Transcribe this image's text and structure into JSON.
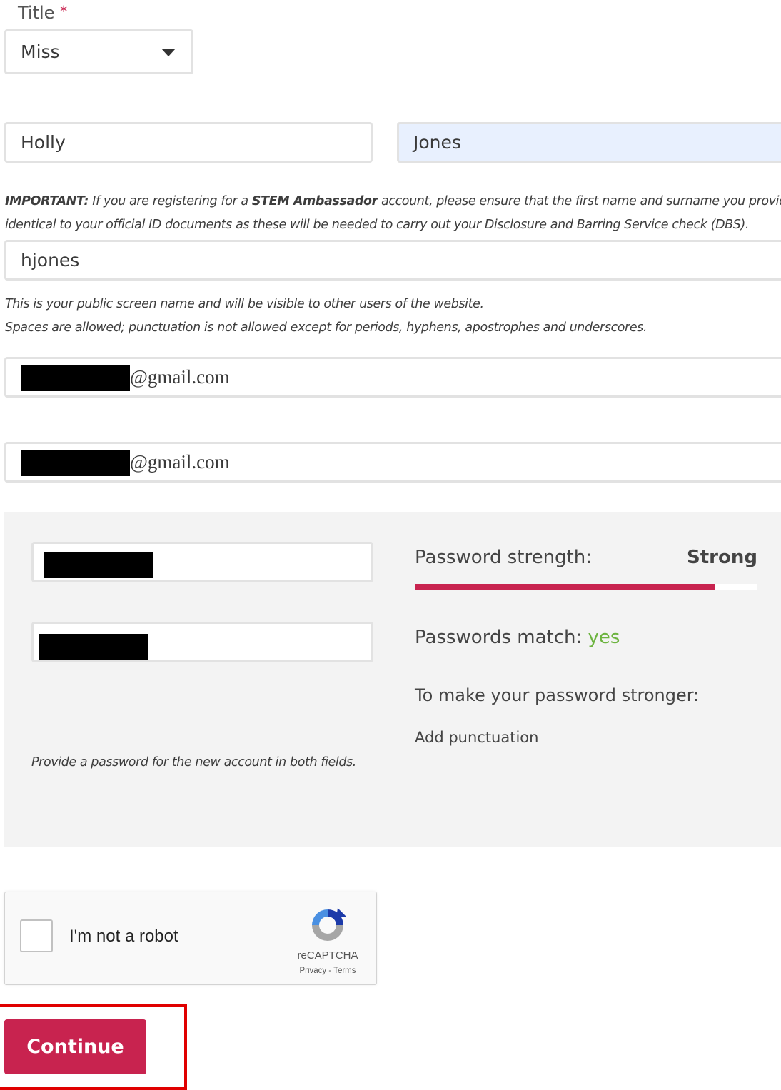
{
  "title_field": {
    "label": "Title",
    "required_mark": "*",
    "value": "Miss"
  },
  "first_name": {
    "value": "Holly"
  },
  "last_name": {
    "value": "Jones"
  },
  "important_note": {
    "prefix": "IMPORTANT:",
    "part1": " If you are registering for a ",
    "emphasis": "STEM Ambassador",
    "part2": " account, please ensure that the first name and surname you provide are",
    "line2": "identical to your official ID documents as these will be needed to carry out your Disclosure and Barring Service check (DBS)."
  },
  "screen_name": {
    "value": "hjones",
    "help_line1": "This is your public screen name and will be visible to other users of the website.",
    "help_line2": "Spaces are allowed; punctuation is not allowed except for periods, hyphens, apostrophes and underscores."
  },
  "email": {
    "suffix": "@gmail.com"
  },
  "email_confirm": {
    "suffix": "@gmail.com"
  },
  "password": {
    "strength_label": "Password strength:",
    "strength_value": "Strong",
    "strength_level": 0.875,
    "match_label": "Passwords match:",
    "match_value": "yes",
    "tips_heading": "To make your password stronger:",
    "tips": [
      "Add punctuation"
    ],
    "help": "Provide a password for the new account in both fields."
  },
  "recaptcha": {
    "label": "I'm not a robot",
    "brand": "reCAPTCHA",
    "privacy": "Privacy",
    "separator": " - ",
    "terms": "Terms"
  },
  "continue_button": {
    "label": "Continue"
  },
  "colors": {
    "accent": "#c8234f",
    "match_yes": "#6cb33f",
    "highlight_border": "#e00000",
    "autofill_bg": "#e8f0fe"
  }
}
